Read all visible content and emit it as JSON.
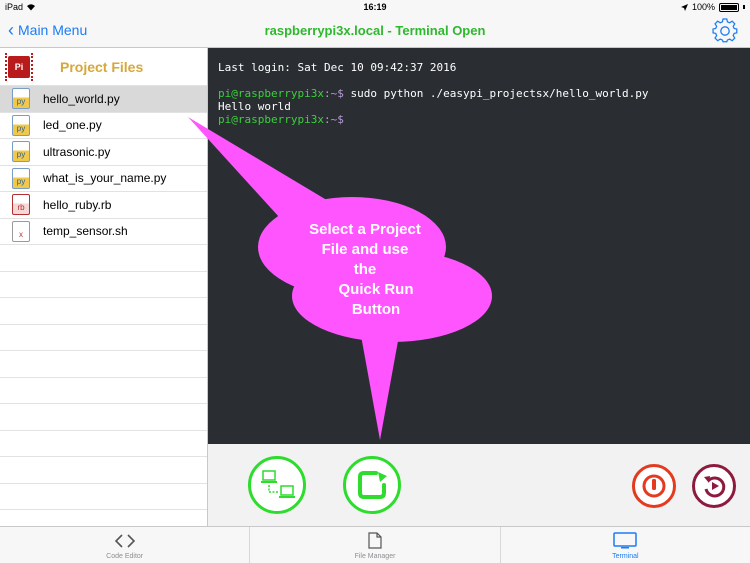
{
  "status": {
    "device": "iPad",
    "time": "16:19",
    "battery": "100%"
  },
  "nav": {
    "back_label": "Main Menu",
    "title": "raspberrypi3x.local - Terminal Open"
  },
  "sidebar": {
    "title": "Project Files",
    "pi_label": "Pi",
    "files": [
      {
        "name": "hello_world.py",
        "type": "py"
      },
      {
        "name": "led_one.py",
        "type": "py"
      },
      {
        "name": "ultrasonic.py",
        "type": "py"
      },
      {
        "name": "what_is_your_name.py",
        "type": "py"
      },
      {
        "name": "hello_ruby.rb",
        "type": "rb"
      },
      {
        "name": "temp_sensor.sh",
        "type": "x"
      }
    ]
  },
  "terminal": {
    "last_login": "Last login: Sat Dec 10 09:42:37 2016",
    "prompt_user": "pi@raspberrypi3x",
    "prompt_path": ":~$",
    "command": " sudo python ./easypi_projectsx/hello_world.py",
    "output": "Hello world"
  },
  "callout": {
    "lines": [
      "Select a Project",
      "File and use",
      "the",
      "Quick Run",
      "Button"
    ]
  },
  "tabs": [
    {
      "label": "Code Editor",
      "icon": "code-icon"
    },
    {
      "label": "File Manager",
      "icon": "document-icon"
    },
    {
      "label": "Terminal",
      "icon": "monitor-icon"
    }
  ],
  "colors": {
    "accent": "#1a7cf5",
    "title_green": "#2fb72f",
    "callout_pink": "#ff55ff",
    "terminal_bg": "#2a2e33",
    "button_green": "#2ddc2d",
    "power_red": "#e43b20",
    "restart_maroon": "#8d1b3d"
  }
}
